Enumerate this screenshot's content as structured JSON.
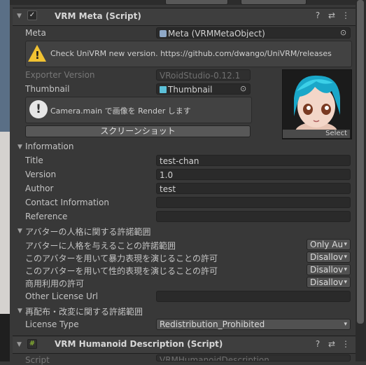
{
  "vrm_meta": {
    "title": "VRM Meta (Script)",
    "meta_label": "Meta",
    "meta_value": "Meta (VRMMetaObject)",
    "warning_text": "Check UniVRM new version. https://github.com/dwango/UniVRM/releases",
    "exporter_version_label": "Exporter Version",
    "exporter_version_value": "VRoidStudio-0.12.1",
    "thumbnail_label": "Thumbnail",
    "thumbnail_value": "Thumbnail",
    "thumbnail_select_label": "Select",
    "render_info_text": "Camera.main で画像を Render します",
    "screenshot_button": "スクリーンショット",
    "information_label": "Information",
    "title_label": "Title",
    "title_value": "test-chan",
    "version_label": "Version",
    "version_value": "1.0",
    "author_label": "Author",
    "author_value": "test",
    "contact_label": "Contact Information",
    "contact_value": "",
    "reference_label": "Reference",
    "reference_value": "",
    "avatar_permission_label": "アバターの人格に関する許諾範囲",
    "allowed_user_label": "アバターに人格を与えることの許諾範囲",
    "allowed_user_value": "Only Au",
    "violent_label": "このアバターを用いて暴力表現を演じることの許可",
    "violent_value": "Disallov",
    "sexual_label": "このアバターを用いて性的表現を演じることの許可",
    "sexual_value": "Disallov",
    "commercial_label": "商用利用の許可",
    "commercial_value": "Disallov",
    "other_license_label": "Other License Url",
    "other_license_value": "",
    "redistribution_label": "再配布・改変に関する許諾範囲",
    "license_type_label": "License Type",
    "license_type_value": "Redistribution_Prohibited"
  },
  "humanoid": {
    "title": "VRM Humanoid Description (Script)",
    "script_label": "Script",
    "script_value": "VRMHumanoidDescription"
  },
  "icons": {
    "help": "?",
    "settings": "⇄",
    "more": "⋮",
    "fold": "▼",
    "check": "✓",
    "script": "#",
    "picker": "⊙",
    "dropdown": "▾",
    "warning": "!",
    "info": "!"
  },
  "colors": {
    "panel_bg": "#383838",
    "field_bg": "#2a2a2a",
    "warning": "#f1c232",
    "script_icon": "#9acd32"
  }
}
